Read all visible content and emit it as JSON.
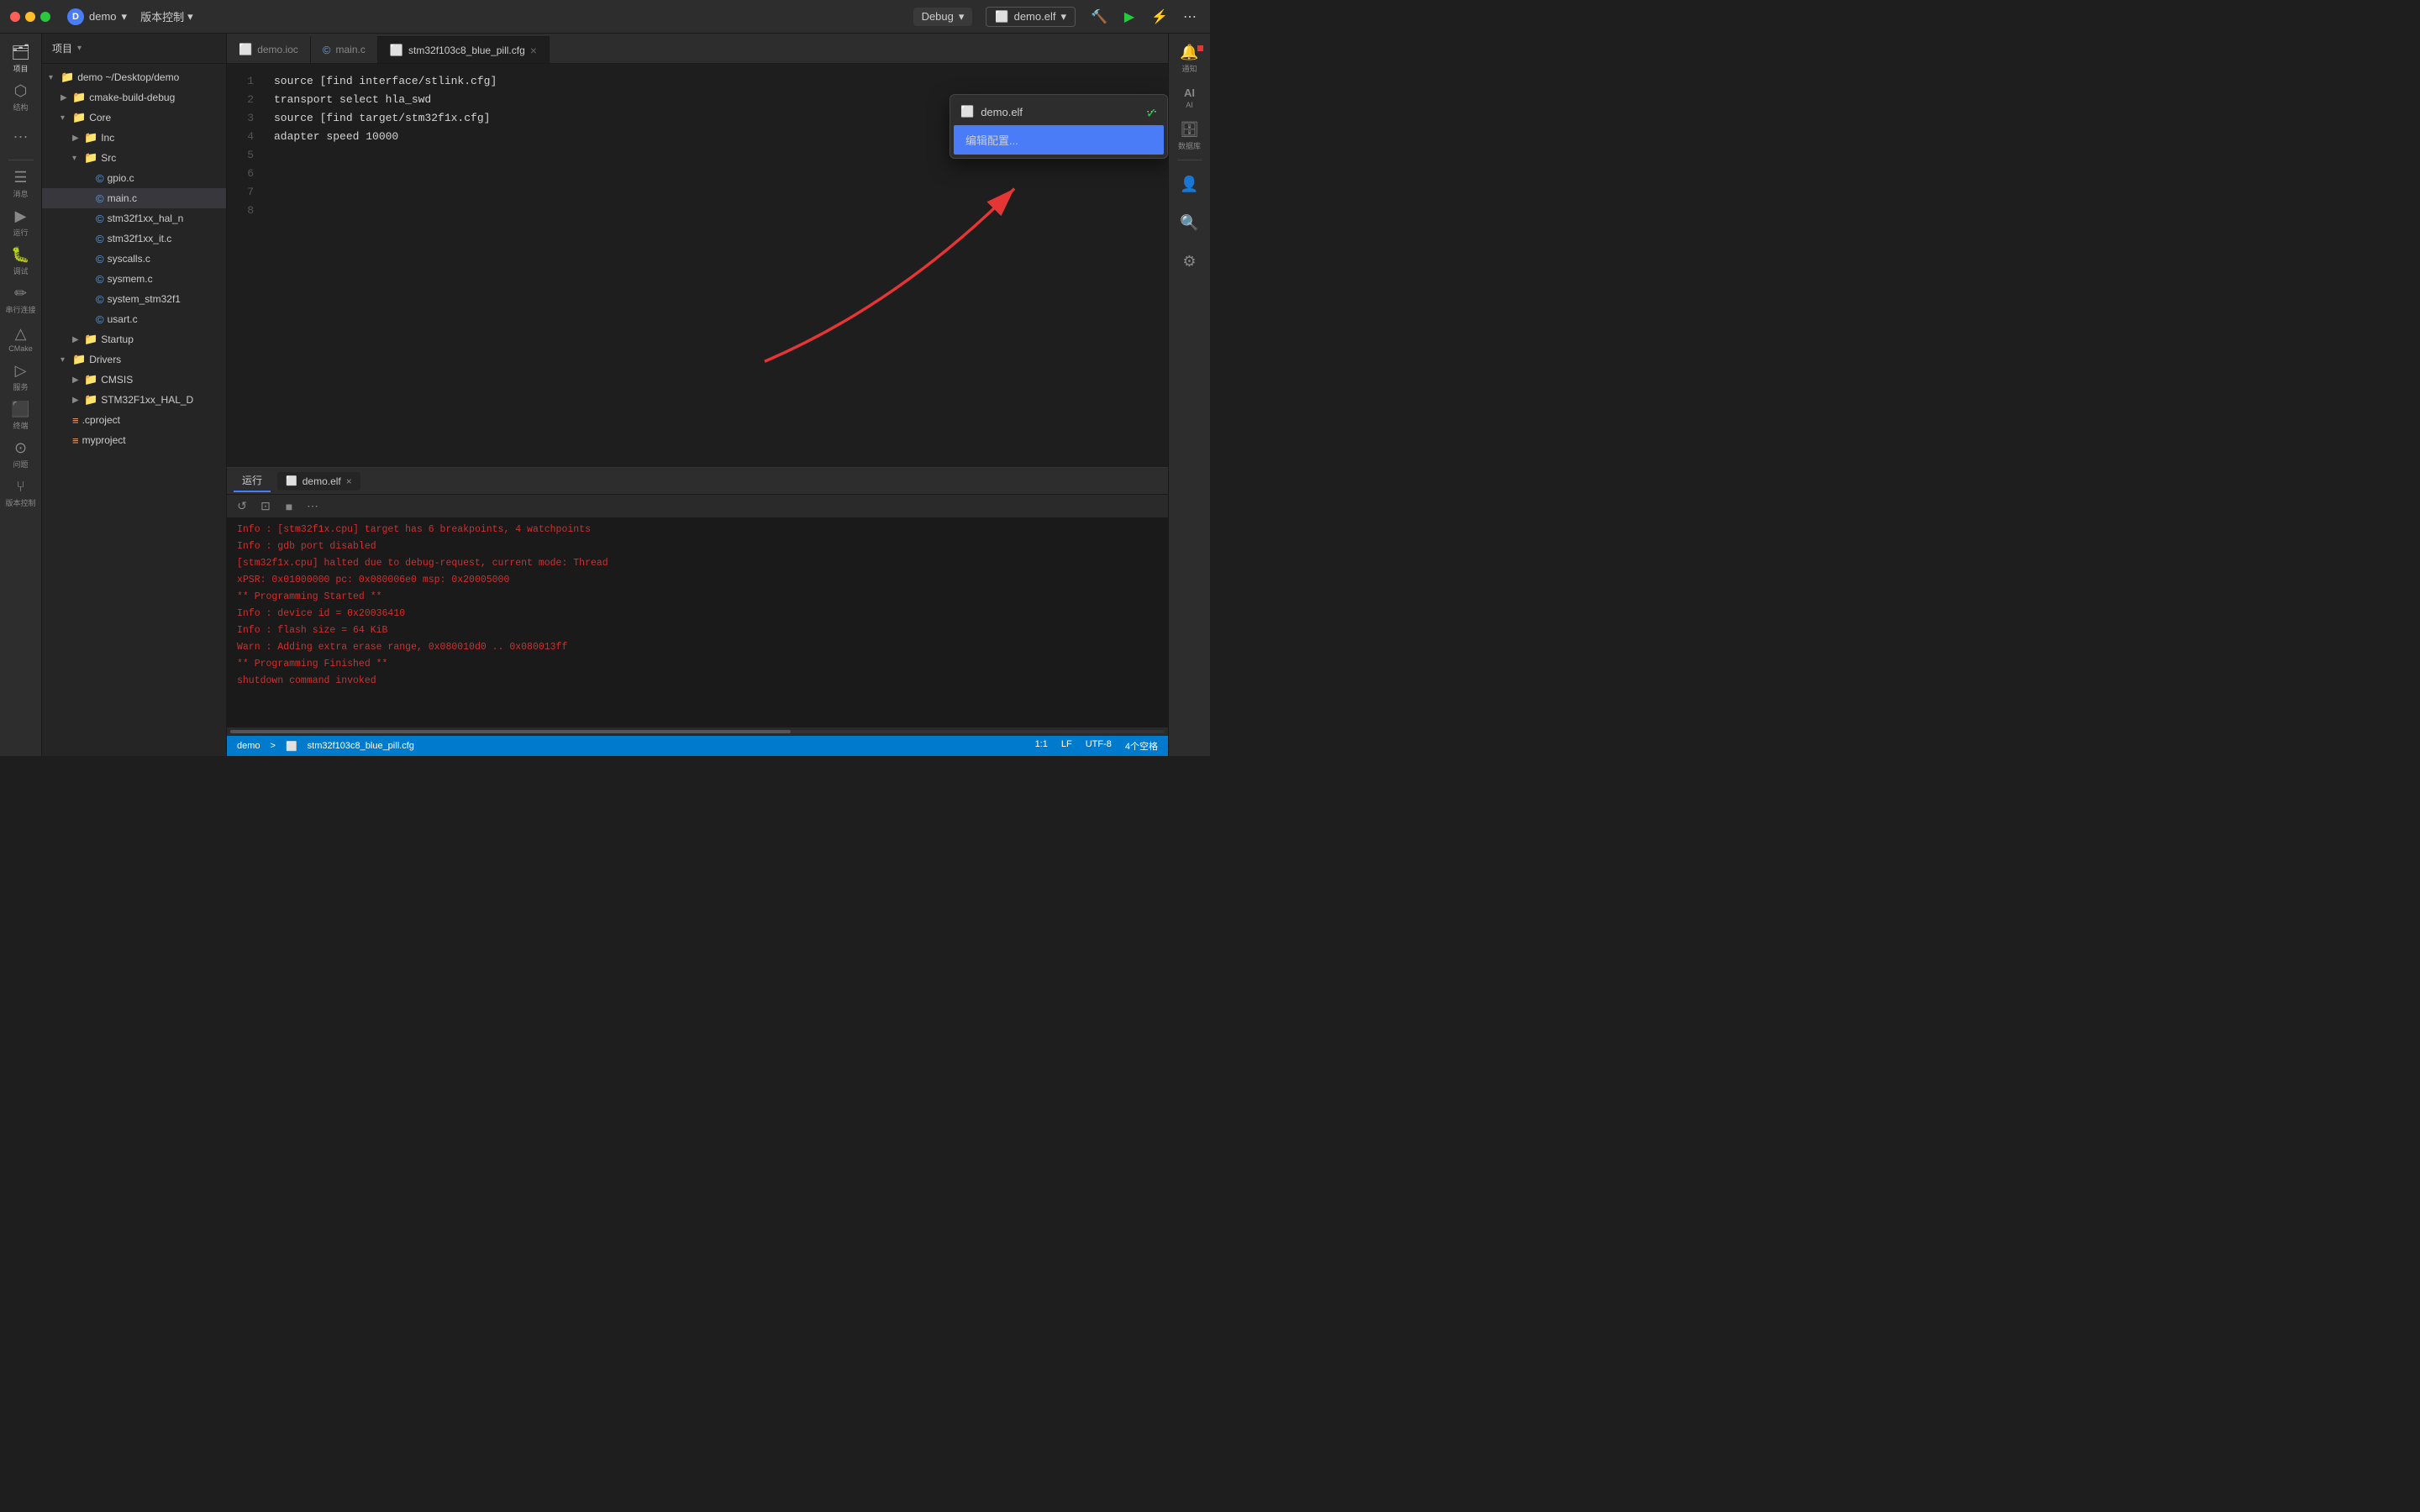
{
  "titlebar": {
    "user": "demo",
    "chevron": "▾",
    "version_control": "版本控制",
    "version_chevron": "▾",
    "debug_label": "Debug",
    "run_config": "demo.elf",
    "run_config_chevron": "▾"
  },
  "sidebar": {
    "items": [
      {
        "id": "explorer",
        "glyph": "🗂",
        "label": "项目",
        "active": true
      },
      {
        "id": "structure",
        "glyph": "⬡",
        "label": "结构"
      },
      {
        "id": "more",
        "glyph": "···",
        "label": ""
      },
      {
        "id": "messages",
        "glyph": "≡",
        "label": "消息"
      },
      {
        "id": "run",
        "glyph": "▶",
        "label": "运行"
      },
      {
        "id": "debug",
        "glyph": "🐛",
        "label": "调试"
      },
      {
        "id": "serial",
        "glyph": "⚡",
        "label": "串行连接"
      },
      {
        "id": "cmake",
        "glyph": "△",
        "label": "CMake"
      },
      {
        "id": "services",
        "glyph": "▷",
        "label": "服务"
      },
      {
        "id": "terminal",
        "glyph": "⬛",
        "label": "终端"
      },
      {
        "id": "issues",
        "glyph": "⊙",
        "label": "问题"
      },
      {
        "id": "vcs",
        "glyph": "⑂",
        "label": "版本控制"
      }
    ]
  },
  "file_tree": {
    "header": "项目",
    "nodes": [
      {
        "id": "demo-root",
        "label": "demo  ~/Desktop/demo",
        "indent": 0,
        "expanded": true,
        "type": "folder"
      },
      {
        "id": "cmake-build",
        "label": "cmake-build-debug",
        "indent": 1,
        "expanded": false,
        "type": "folder"
      },
      {
        "id": "Core",
        "label": "Core",
        "indent": 1,
        "expanded": true,
        "type": "folder"
      },
      {
        "id": "Inc",
        "label": "Inc",
        "indent": 2,
        "expanded": false,
        "type": "folder"
      },
      {
        "id": "Src",
        "label": "Src",
        "indent": 2,
        "expanded": true,
        "type": "folder"
      },
      {
        "id": "gpio-c",
        "label": "gpio.c",
        "indent": 3,
        "expanded": false,
        "type": "file-c"
      },
      {
        "id": "main-c",
        "label": "main.c",
        "indent": 3,
        "expanded": false,
        "type": "file-c",
        "selected": true
      },
      {
        "id": "stm32f1xx-hal-n",
        "label": "stm32f1xx_hal_n",
        "indent": 3,
        "expanded": false,
        "type": "file-c"
      },
      {
        "id": "stm32f1xx-it-c",
        "label": "stm32f1xx_it.c",
        "indent": 3,
        "expanded": false,
        "type": "file-c"
      },
      {
        "id": "syscalls-c",
        "label": "syscalls.c",
        "indent": 3,
        "expanded": false,
        "type": "file-c"
      },
      {
        "id": "sysmem-c",
        "label": "sysmem.c",
        "indent": 3,
        "expanded": false,
        "type": "file-c"
      },
      {
        "id": "system-stm32f1",
        "label": "system_stm32f1",
        "indent": 3,
        "expanded": false,
        "type": "file-c"
      },
      {
        "id": "usart-c",
        "label": "usart.c",
        "indent": 3,
        "expanded": false,
        "type": "file-c"
      },
      {
        "id": "Startup",
        "label": "Startup",
        "indent": 2,
        "expanded": false,
        "type": "folder"
      },
      {
        "id": "Drivers",
        "label": "Drivers",
        "indent": 1,
        "expanded": true,
        "type": "folder"
      },
      {
        "id": "CMSIS",
        "label": "CMSIS",
        "indent": 2,
        "expanded": false,
        "type": "folder"
      },
      {
        "id": "STM32F1xx-HAL-D",
        "label": "STM32F1xx_HAL_D",
        "indent": 2,
        "expanded": false,
        "type": "folder"
      },
      {
        "id": "cproject",
        "label": ".cproject",
        "indent": 1,
        "expanded": false,
        "type": "file-xml"
      },
      {
        "id": "myproject",
        "label": "myproject",
        "indent": 1,
        "expanded": false,
        "type": "file-xml"
      }
    ]
  },
  "tabs": [
    {
      "id": "demo-ioc",
      "label": "demo.ioc",
      "type": "ioc",
      "active": false,
      "closable": false
    },
    {
      "id": "main-c",
      "label": "main.c",
      "type": "c",
      "active": false,
      "closable": false
    },
    {
      "id": "stm32f103c8-cfg",
      "label": "stm32f103c8_blue_pill.cfg",
      "type": "cfg",
      "active": true,
      "closable": true
    }
  ],
  "code": {
    "lines": [
      {
        "num": 1,
        "text": "source [find interface/stlink.cfg]"
      },
      {
        "num": 2,
        "text": "transport select hla_swd"
      },
      {
        "num": 3,
        "text": ""
      },
      {
        "num": 4,
        "text": "source [find target/stm32f1x.cfg]"
      },
      {
        "num": 5,
        "text": "adapter speed 10000"
      },
      {
        "num": 6,
        "text": ""
      },
      {
        "num": 7,
        "text": ""
      },
      {
        "num": 8,
        "text": ""
      }
    ]
  },
  "dropdown": {
    "title": "demo.elf",
    "title_icon": "cfg",
    "edit_label": "编辑配置...",
    "more_icon": "⋯"
  },
  "bottom_panel": {
    "tab_label": "运行",
    "subtab_label": "demo.elf",
    "toolbar_icons": [
      "↺",
      "⊡",
      "■",
      "⋯"
    ],
    "terminal_lines": [
      "Info : [stm32f1x.cpu] target has 6 breakpoints, 4 watchpoints",
      "Info : gdb port disabled",
      "[stm32f1x.cpu] halted due to debug-request, current mode: Thread",
      "xPSR: 0x01000000 pc: 0x080006e0 msp: 0x20005000",
      "** Programming Started **",
      "Info : device id = 0x20036410",
      "Info : flash size = 64 KiB",
      "Warn : Adding extra erase range, 0x080010d0 .. 0x080013ff",
      "** Programming Finished **",
      "shutdown command invoked"
    ]
  },
  "status_bar": {
    "breadcrumb": "demo",
    "breadcrumb_sep": ">",
    "file_label": "stm32f103c8_blue_pill.cfg",
    "position": "1:1",
    "line_ending": "LF",
    "encoding": "UTF-8",
    "indent": "4个空格"
  },
  "right_bar": {
    "items": [
      {
        "id": "notifications",
        "glyph": "🔔",
        "label": "通知",
        "badge": true
      },
      {
        "id": "ai",
        "glyph": "AI",
        "label": "AI"
      },
      {
        "id": "database",
        "glyph": "🗄",
        "label": "数据库"
      },
      {
        "id": "user",
        "glyph": "👤",
        "label": ""
      },
      {
        "id": "search",
        "glyph": "🔍",
        "label": ""
      },
      {
        "id": "settings",
        "glyph": "⚙",
        "label": ""
      }
    ]
  }
}
